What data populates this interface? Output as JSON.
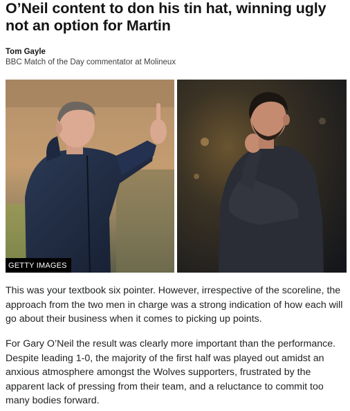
{
  "article": {
    "headline": "O’Neil content to don his tin hat, winning ugly not an option for Martin",
    "author": {
      "name": "Tom Gayle",
      "role": "BBC Match of the Day commentator at Molineux"
    },
    "image": {
      "credit": "GETTY IMAGES"
    },
    "paragraphs": [
      "This was your textbook six pointer. However, irrespective of the scoreline, the approach from the two men in charge was a strong indication of how each will go about their business when it comes to picking up points.",
      "For Gary O’Neil the result was clearly more important than the performance. Despite leading 1-0, the majority of the first half was played out amidst an anxious atmosphere amongst the Wolves supporters, frustrated by the apparent lack of pressing from their team, and a reluctance to commit too many bodies forward."
    ]
  },
  "colors": {
    "text": "#202224",
    "credit_bg": "#000000",
    "credit_text": "#ffffff"
  }
}
